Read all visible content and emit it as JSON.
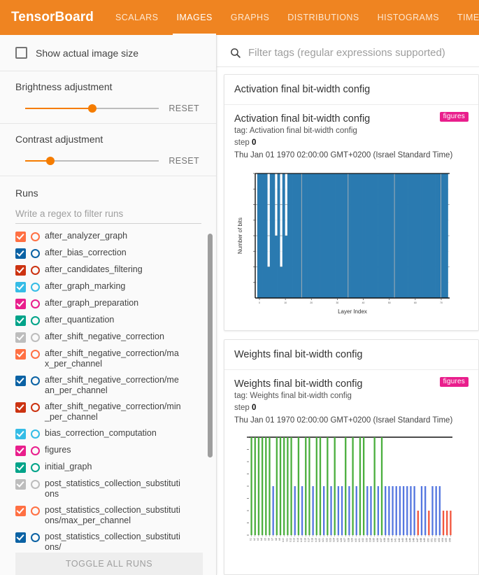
{
  "app": {
    "brand": "TensorBoard",
    "accent": "#ef8421"
  },
  "nav": {
    "tabs": [
      {
        "label": "SCALARS",
        "active": false
      },
      {
        "label": "IMAGES",
        "active": true
      },
      {
        "label": "GRAPHS",
        "active": false
      },
      {
        "label": "DISTRIBUTIONS",
        "active": false
      },
      {
        "label": "HISTOGRAMS",
        "active": false
      },
      {
        "label": "TIME SERIES",
        "active": false
      }
    ]
  },
  "sidebar": {
    "show_actual_size": {
      "label": "Show actual image size",
      "checked": false
    },
    "brightness": {
      "label": "Brightness adjustment",
      "reset_label": "RESET",
      "value_pct": 50
    },
    "contrast": {
      "label": "Contrast adjustment",
      "reset_label": "RESET",
      "value_pct": 19
    },
    "runs_label": "Runs",
    "regex_placeholder": "Write a regex to filter runs",
    "regex_value": "",
    "toggle_all_label": "TOGGLE ALL RUNS",
    "runs": [
      {
        "name": "after_analyzer_graph",
        "color": "#ff7043",
        "enabled": true
      },
      {
        "name": "after_bias_correction",
        "color": "#0b62a4",
        "enabled": true
      },
      {
        "name": "after_candidates_filtering",
        "color": "#cc3311",
        "enabled": true
      },
      {
        "name": "after_graph_marking",
        "color": "#35bce6",
        "enabled": true
      },
      {
        "name": "after_graph_preparation",
        "color": "#e91e8c",
        "enabled": true
      },
      {
        "name": "after_quantization",
        "color": "#00a389",
        "enabled": true
      },
      {
        "name": "after_shift_negative_correction",
        "color": "#bdbdbd",
        "enabled": false
      },
      {
        "name": "after_shift_negative_correction/max_per_channel",
        "color": "#ff7043",
        "enabled": true
      },
      {
        "name": "after_shift_negative_correction/mean_per_channel",
        "color": "#0b62a4",
        "enabled": true
      },
      {
        "name": "after_shift_negative_correction/min_per_channel",
        "color": "#cc3311",
        "enabled": true
      },
      {
        "name": "bias_correction_computation",
        "color": "#35bce6",
        "enabled": true
      },
      {
        "name": "figures",
        "color": "#e91e8c",
        "enabled": true
      },
      {
        "name": "initial_graph",
        "color": "#00a389",
        "enabled": true
      },
      {
        "name": "post_statistics_collection_substitutions",
        "color": "#bdbdbd",
        "enabled": false
      },
      {
        "name": "post_statistics_collection_substitutions/max_per_channel",
        "color": "#ff7043",
        "enabled": true
      },
      {
        "name": "post_statistics_collection_substitutions/",
        "color": "#0b62a4",
        "enabled": true
      }
    ]
  },
  "filter": {
    "placeholder": "Filter tags (regular expressions supported)",
    "value": "",
    "icon": "search-icon"
  },
  "cards": [
    {
      "header": "Activation final bit-width config",
      "title": "Activation final bit-width config",
      "tag_line": "tag: Activation final bit-width config",
      "step_label": "step",
      "step_value": "0",
      "date": "Thu Jan 01 1970 02:00:00 GMT+0200 (Israel Standard Time)",
      "badge": "figures"
    },
    {
      "header": "Weights final bit-width config",
      "title": "Weights final bit-width config",
      "tag_line": "tag: Weights final bit-width config",
      "step_label": "step",
      "step_value": "0",
      "date": "Thu Jan 01 1970 02:00:00 GMT+0200 (Israel Standard Time)",
      "badge": "figures"
    }
  ],
  "chart_data": [
    {
      "type": "bar",
      "title": "Activation final bit-width config",
      "xlabel": "Layer Index",
      "ylabel": "Number of bits",
      "ylim": [
        0,
        8
      ],
      "grid": true,
      "bar_color": "#2a7ab0",
      "note": "Dense near-contiguous bars; most layers at 8 bits, three narrow dips to ~4 bits and ~2 bits",
      "x": [
        0,
        1,
        2,
        3,
        4,
        5,
        6,
        7,
        8,
        9,
        10,
        11,
        12,
        13,
        14,
        15,
        16,
        17,
        18,
        19,
        20,
        21,
        22,
        23,
        24,
        25,
        26,
        27,
        28,
        29,
        30,
        31,
        32,
        33,
        34,
        35,
        36,
        37,
        38,
        39,
        40,
        41,
        42,
        43,
        44,
        45,
        46,
        47,
        48,
        49,
        50,
        51,
        52,
        53,
        54,
        55,
        56,
        57,
        58,
        59,
        60,
        61,
        62,
        63,
        64,
        65,
        66,
        67,
        68,
        69,
        70,
        71,
        72,
        73,
        74,
        75
      ],
      "values": [
        8,
        8,
        8,
        8,
        2,
        8,
        8,
        4,
        8,
        2,
        8,
        4,
        8,
        8,
        8,
        8,
        8,
        8,
        8,
        8,
        8,
        8,
        8,
        8,
        8,
        8,
        8,
        8,
        8,
        8,
        8,
        8,
        8,
        8,
        8,
        8,
        8,
        8,
        8,
        8,
        8,
        8,
        8,
        8,
        8,
        8,
        8,
        8,
        8,
        8,
        8,
        8,
        8,
        8,
        8,
        8,
        8,
        8,
        8,
        8,
        8,
        8,
        8,
        8,
        8,
        8,
        8,
        8,
        8,
        8,
        8,
        8,
        8,
        8,
        8,
        8
      ]
    },
    {
      "type": "bar",
      "title": "Weights final bit-width config",
      "xlabel": "",
      "ylabel": "",
      "ylim": [
        0,
        8
      ],
      "grid": false,
      "colors": {
        "high": "#4caf3f",
        "mid": "#5577e0",
        "low": "#f2553d"
      },
      "note": "Green bars = 8 bits, blue bars = 4 bits, red bars = 2 bits",
      "categories": [
        "b1",
        "b2",
        "b3",
        "b4",
        "b5",
        "b6",
        "b7",
        "b8",
        "b9",
        "b10",
        "b11",
        "b12",
        "b13",
        "b14",
        "b15",
        "b16",
        "b17",
        "b18",
        "b19",
        "b20",
        "b21",
        "b22",
        "b23",
        "b24",
        "b25",
        "b26",
        "b27",
        "b28",
        "b29",
        "b30",
        "b31",
        "b32",
        "b33",
        "b34",
        "b35",
        "b36",
        "b37",
        "b38",
        "b39",
        "b40",
        "b41",
        "b42",
        "b43",
        "b44",
        "b45",
        "b46",
        "b47",
        "b48",
        "b49",
        "b50",
        "b51",
        "b52",
        "b53",
        "b54",
        "b55",
        "b56"
      ],
      "values": [
        8,
        8,
        8,
        8,
        8,
        8,
        4,
        8,
        8,
        8,
        8,
        8,
        4,
        8,
        4,
        8,
        8,
        4,
        8,
        8,
        4,
        8,
        4,
        8,
        4,
        4,
        8,
        4,
        8,
        4,
        8,
        8,
        4,
        4,
        8,
        4,
        8,
        4,
        4,
        4,
        4,
        4,
        4,
        4,
        4,
        4,
        2,
        4,
        4,
        2,
        4,
        4,
        4,
        2,
        2,
        2
      ]
    }
  ]
}
